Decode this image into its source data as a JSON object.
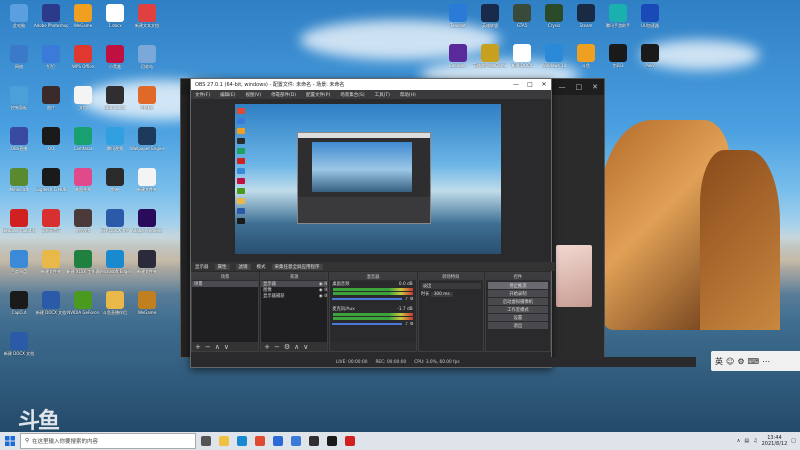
{
  "desktop": {
    "icons_left": [
      {
        "label": "此电脑",
        "color": "#5aa0e0"
      },
      {
        "label": "Adobe Photoshop",
        "color": "#2b3a8a"
      },
      {
        "label": "WeGame",
        "color": "#f0a020"
      },
      {
        "label": "1.docx",
        "color": "#ffffff"
      },
      {
        "label": "新建文本文档",
        "color": "#e04040"
      },
      {
        "label": "网络",
        "color": "#3a7ac8"
      },
      {
        "label": "钉钉",
        "color": "#3a7ad8"
      },
      {
        "label": "WPS Office",
        "color": "#e0382f"
      },
      {
        "label": "小黑盒",
        "color": "#c01040"
      },
      {
        "label": "回收站",
        "color": "#7aa8d8"
      },
      {
        "label": "控制面板",
        "color": "#4aa0d8"
      },
      {
        "label": "图片",
        "color": "#3a2a2a"
      },
      {
        "label": "文档",
        "color": "#f4f4f4"
      },
      {
        "label": "OBS Studio",
        "color": "#302e31"
      },
      {
        "label": "全民K歌",
        "color": "#e06828"
      },
      {
        "label": "OBS直播",
        "color": "#3a4aa0"
      },
      {
        "label": "QQ",
        "color": "#1a1a1a"
      },
      {
        "label": "Camtasia",
        "color": "#18a070"
      },
      {
        "label": "腾讯视频",
        "color": "#30a0e0"
      },
      {
        "label": "Wallpaper Engine",
        "color": "#1e3a5a"
      },
      {
        "label": "Minecraft",
        "color": "#5a8a30"
      },
      {
        "label": "Logitech G HUB",
        "color": "#1a1a1a"
      },
      {
        "label": "美图秀秀",
        "color": "#e04a8a"
      },
      {
        "label": "剪映",
        "color": "#2a2a2a"
      },
      {
        "label": "新建文件夹",
        "color": "#f4f4f4"
      },
      {
        "label": "NetEase Cloud Music",
        "color": "#d02020"
      },
      {
        "label": "网易云音乐",
        "color": "#d83030"
      },
      {
        "label": "教程视频",
        "color": "#4a3a3a"
      },
      {
        "label": "新建 DOCX 文档",
        "color": "#2a5aa8"
      },
      {
        "label": "Adobe Premiere",
        "color": "#2a0a5a"
      },
      {
        "label": "百度网盘",
        "color": "#3a8ad8"
      },
      {
        "label": "新建文件夹",
        "color": "#e8b848"
      },
      {
        "label": "新建 XLSX 工作表",
        "color": "#208040"
      },
      {
        "label": "Microsoft Edge",
        "color": "#1a8ad0"
      },
      {
        "label": "新建文件夹",
        "color": "#2a2a3a"
      },
      {
        "label": "CapCut",
        "color": "#1a1a1a"
      },
      {
        "label": "新建 DOCX 文档",
        "color": "#2a5aa8"
      },
      {
        "label": "NVIDIA GeForce",
        "color": "#4a9a20"
      },
      {
        "label": "斗鱼直播伴侣",
        "color": "#e8b848"
      },
      {
        "label": "WeGame",
        "color": "#c08020"
      },
      {
        "label": "新建 DOCX 文档",
        "color": "#2a5aa8"
      }
    ],
    "icons_right": [
      {
        "label": "Tencent",
        "color": "#2a7ad8"
      },
      {
        "label": "英雄联盟",
        "color": "#1a2a4a"
      },
      {
        "label": "GTA5",
        "color": "#3a4a3a"
      },
      {
        "label": "Crysis",
        "color": "#2a4a2a"
      },
      {
        "label": "Steam",
        "color": "#1a2a44"
      },
      {
        "label": "腾讯手游助手",
        "color": "#1ab0b0"
      },
      {
        "label": "UU加速器",
        "color": "#1a4ab8"
      },
      {
        "label": "Blender",
        "color": "#5a2a9a"
      },
      {
        "label": "英雄联盟WeGame",
        "color": "#c8a020"
      },
      {
        "label": "新建 DOCX",
        "color": "#ffffff"
      },
      {
        "label": "Windows 10",
        "color": "#2a8ad8"
      },
      {
        "label": "斗鱼",
        "color": "#f0a020"
      },
      {
        "label": "剑网3",
        "color": "#1a1a1a"
      },
      {
        "label": "Pixiv",
        "color": "#1a1a1a"
      }
    ]
  },
  "obs": {
    "title": "OBS 27.0.1 (64-bit, windows) - 配置文件: 未命名 - 场景: 未命名",
    "menu": [
      "文件(F)",
      "编辑(E)",
      "视图(V)",
      "停靠部件(D)",
      "配置文件(P)",
      "场景集合(S)",
      "工具(T)",
      "帮助(H)"
    ],
    "topbar": {
      "source_label": "显示器",
      "props": "属性",
      "filters": "滤镜",
      "mode": "模式",
      "mode_value": "采集任意全屏应用程序"
    },
    "docks": {
      "scenes": {
        "header": "场景",
        "items": [
          "场景"
        ]
      },
      "sources": {
        "header": "来源",
        "items": [
          "显示器",
          "图像",
          "显示器捕获"
        ]
      },
      "mixer": {
        "header": "混音器",
        "tracks": [
          {
            "name": "桌面音频",
            "db": "0.0 dB"
          },
          {
            "name": "麦克风/Aux",
            "db": "-1.7 dB"
          }
        ]
      },
      "transitions": {
        "header": "转场特效",
        "type": "淡出",
        "duration_label": "时长",
        "duration": "300 ms"
      },
      "controls": {
        "header": "控件",
        "buttons": [
          "停止推流",
          "开始录制",
          "启动虚拟摄像机",
          "工作室模式",
          "设置",
          "退出"
        ]
      }
    },
    "status": {
      "live": "LIVE: 00:00:00",
      "rec": "REC: 00:00:00",
      "cpu": "CPU: 3.0%, 60.00 fps"
    }
  },
  "ime": {
    "lang": "英",
    "items": [
      "☺",
      "⚙",
      "⌨",
      "⋯"
    ]
  },
  "watermark": "斗鱼",
  "taskbar": {
    "search_placeholder": "在这里输入你要搜索的内容",
    "time": "13:44",
    "date": "2021/8/12",
    "pinned": [
      {
        "name": "task-view",
        "color": "#555"
      },
      {
        "name": "file-explorer",
        "color": "#f0c040"
      },
      {
        "name": "edge",
        "color": "#1a8ad0"
      },
      {
        "name": "chrome",
        "color": "#e04a30"
      },
      {
        "name": "store",
        "color": "#2a6ad8"
      },
      {
        "name": "mail",
        "color": "#3a7ad8"
      },
      {
        "name": "obs",
        "color": "#302e31"
      },
      {
        "name": "qq",
        "color": "#1a1a1a"
      },
      {
        "name": "netease-music",
        "color": "#d02020"
      }
    ]
  }
}
